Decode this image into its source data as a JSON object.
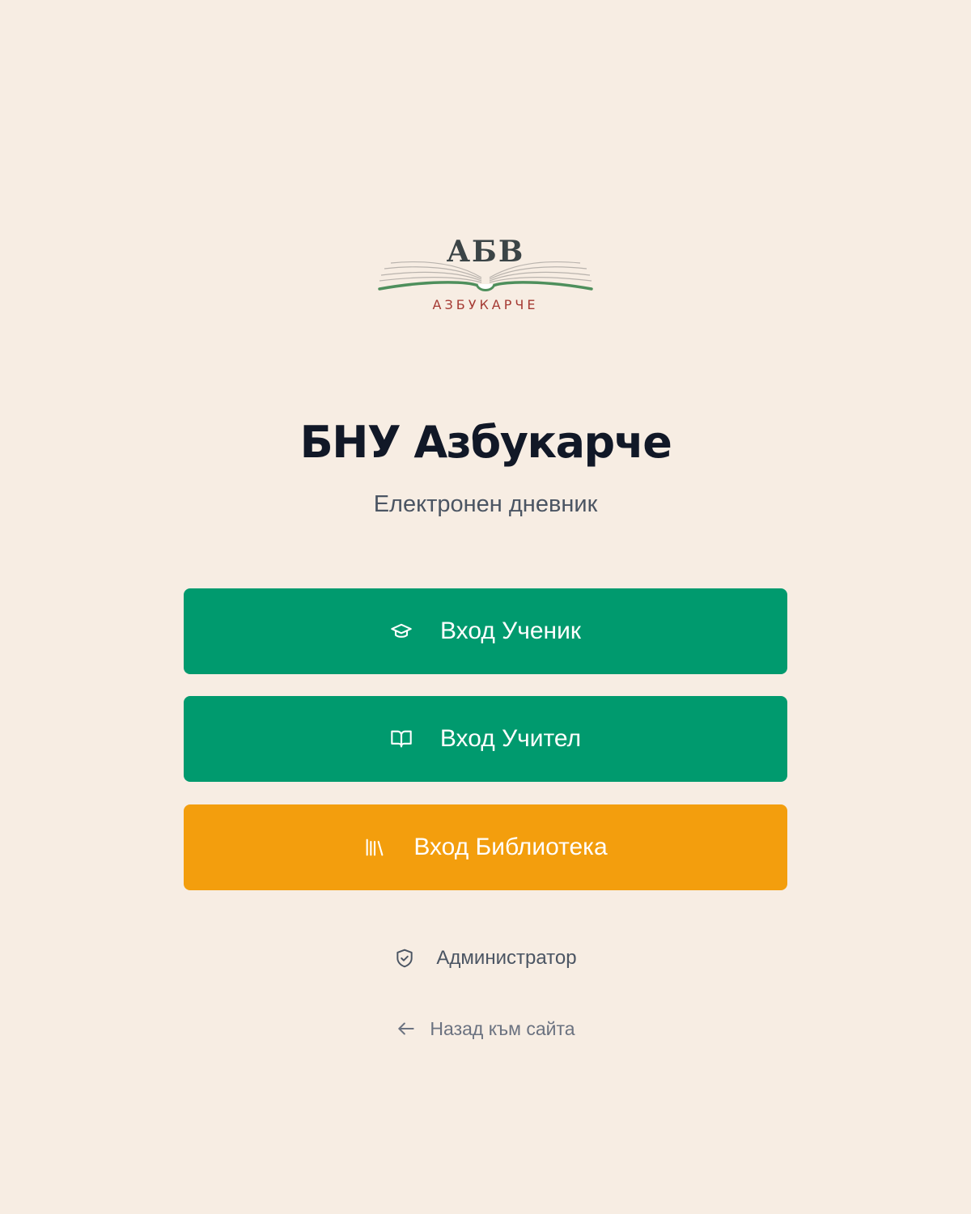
{
  "theme": {
    "background": "#f7ede3",
    "primary_green": "#009a6e",
    "library_orange": "#f39e0d",
    "heading_color": "#111827",
    "muted_text": "#4b5563",
    "logo_green": "#4e8f5c",
    "logo_red": "#a53a33",
    "logo_dark": "#3b4446"
  },
  "logo": {
    "letters": "АБВ",
    "wordmark": "АЗБУКАРЧЕ",
    "icon": "open-book-icon"
  },
  "header": {
    "title": "БНУ Азбукарче",
    "subtitle": "Електронен дневник"
  },
  "buttons": [
    {
      "id": "student",
      "label": "Вход Ученик",
      "icon": "graduation-cap-icon",
      "color": "#009a6e"
    },
    {
      "id": "teacher",
      "label": "Вход Учител",
      "icon": "open-book-icon",
      "color": "#009a6e"
    },
    {
      "id": "library",
      "label": "Вход Библиотека",
      "icon": "library-books-icon",
      "color": "#f39e0d"
    }
  ],
  "admin": {
    "label": "Администратор",
    "icon": "shield-check-icon"
  },
  "back": {
    "label": "Назад към сайта",
    "icon": "arrow-left-icon"
  }
}
